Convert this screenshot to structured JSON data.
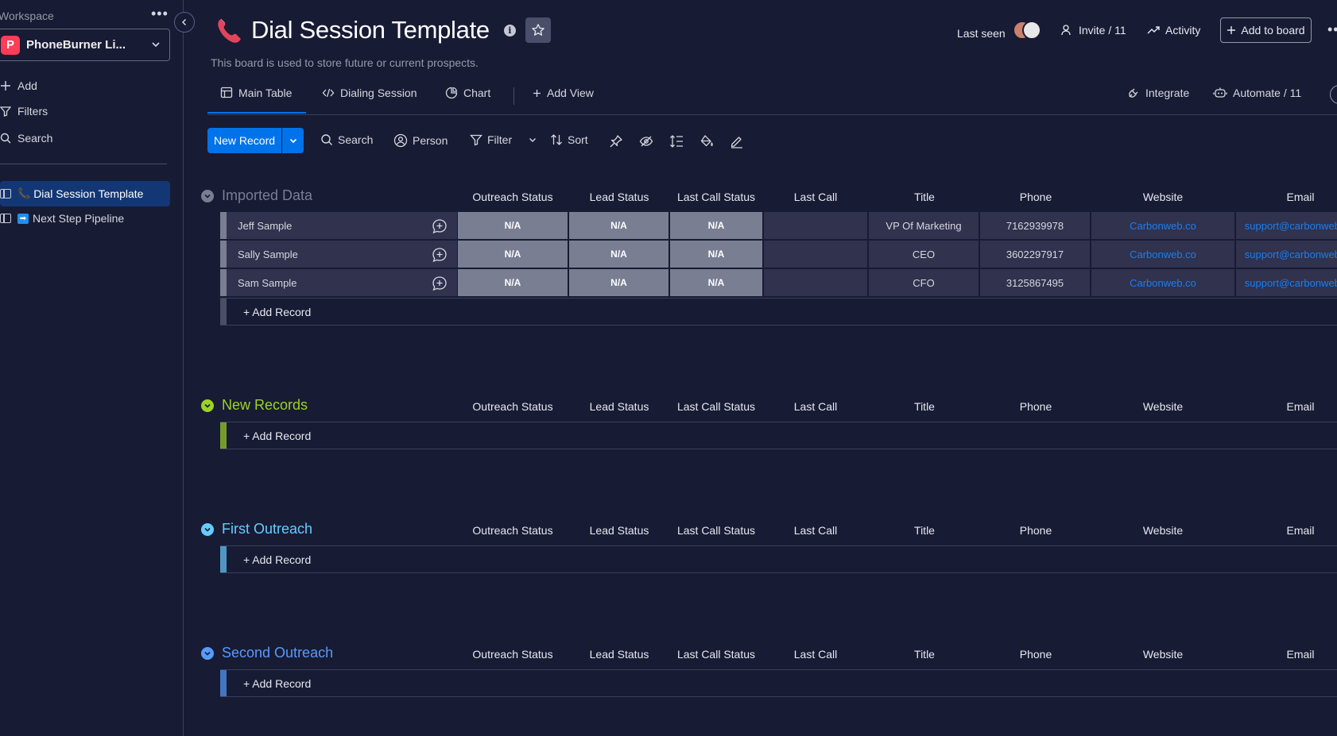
{
  "sidebar": {
    "workspace_label": "Workspace",
    "workspace_badge": "P",
    "workspace_name": "PhoneBurner Li...",
    "actions": {
      "add": "Add",
      "filters": "Filters",
      "search": "Search"
    },
    "boards": [
      {
        "label": "Dial Session Template",
        "icon": "phone-emoji"
      },
      {
        "label": "Next Step Pipeline",
        "icon": "arrow-emoji"
      }
    ]
  },
  "header": {
    "title": "Dial Session Template",
    "description": "This board is used to store future or current prospects.",
    "last_seen": "Last seen",
    "invite": "Invite / 11",
    "activity": "Activity",
    "add_to_board": "Add to board"
  },
  "tabs": {
    "main_table": "Main Table",
    "dialing_session": "Dialing Session",
    "chart": "Chart",
    "add_view": "Add View",
    "integrate": "Integrate",
    "automate": "Automate / 11"
  },
  "toolbar": {
    "new_record": "New Record",
    "search": "Search",
    "person": "Person",
    "filter": "Filter",
    "sort": "Sort"
  },
  "columns": [
    "Outreach Status",
    "Lead Status",
    "Last Call Status",
    "Last Call",
    "Title",
    "Phone",
    "Website",
    "Email"
  ],
  "add_record_label": "+ Add Record",
  "groups": [
    {
      "title": "Imported Data",
      "color": "#797e93",
      "rows": [
        {
          "name": "Jeff Sample",
          "outreach": "N/A",
          "lead": "N/A",
          "last_call_status": "N/A",
          "last_call": "",
          "title": "VP Of Marketing",
          "phone": "7162939978",
          "website": "Carbonweb.co",
          "email": "support@carbonweb.co"
        },
        {
          "name": "Sally Sample",
          "outreach": "N/A",
          "lead": "N/A",
          "last_call_status": "N/A",
          "last_call": "",
          "title": "CEO",
          "phone": "3602297917",
          "website": "Carbonweb.co",
          "email": "support@carbonweb.co"
        },
        {
          "name": "Sam Sample",
          "outreach": "N/A",
          "lead": "N/A",
          "last_call_status": "N/A",
          "last_call": "",
          "title": "CFO",
          "phone": "3125867495",
          "website": "Carbonweb.co",
          "email": "support@carbonweb.co"
        }
      ]
    },
    {
      "title": "New Records",
      "color": "#9cd326",
      "rows": []
    },
    {
      "title": "First Outreach",
      "color": "#66ccff",
      "rows": []
    },
    {
      "title": "Second Outreach",
      "color": "#579bfc",
      "rows": []
    }
  ]
}
